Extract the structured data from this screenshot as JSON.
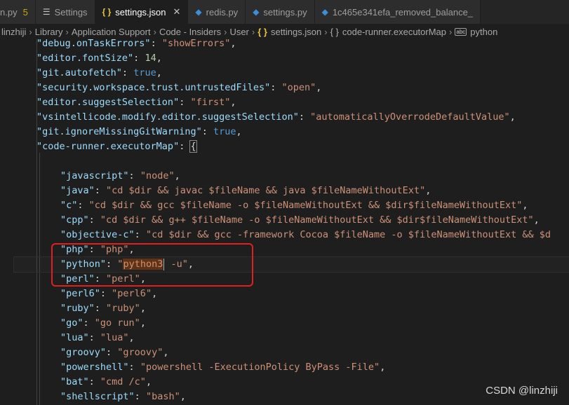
{
  "tabs": [
    {
      "label": "n.py",
      "icon": "python-file-icon",
      "badge": "5",
      "active": false
    },
    {
      "label": "Settings",
      "icon": "settings-icon",
      "active": false
    },
    {
      "label": "settings.json",
      "icon": "json-file-icon",
      "active": true
    },
    {
      "label": "redis.py",
      "icon": "python-file-icon",
      "active": false
    },
    {
      "label": "settings.py",
      "icon": "python-file-icon",
      "active": false
    },
    {
      "label": "1c465e341efa_removed_balance_",
      "icon": "python-file-icon",
      "active": false
    }
  ],
  "close_glyph": "✕",
  "breadcrumb": {
    "parts": [
      "linzhiji",
      "Library",
      "Application Support",
      "Code - Insiders",
      "User",
      "settings.json",
      "code-runner.executorMap",
      "python"
    ],
    "json_icon": "{ }",
    "object_icon": "{ }",
    "string_icon": "abc"
  },
  "code": {
    "top": [
      {
        "key": "\"debug.onTaskErrors\"",
        "type": "s",
        "value": "\"showErrors\"",
        "end": ","
      },
      {
        "key": "\"editor.fontSize\"",
        "type": "n",
        "value": "14",
        "end": ","
      },
      {
        "key": "\"git.autofetch\"",
        "type": "b",
        "value": "true",
        "end": ","
      },
      {
        "key": "\"security.workspace.trust.untrustedFiles\"",
        "type": "s",
        "value": "\"open\"",
        "end": ","
      },
      {
        "key": "\"editor.suggestSelection\"",
        "type": "s",
        "value": "\"first\"",
        "end": ","
      },
      {
        "key": "\"vsintellicode.modify.editor.suggestSelection\"",
        "type": "s",
        "value": "\"automaticallyOverrodeDefaultValue\"",
        "end": ","
      },
      {
        "key": "\"git.ignoreMissingGitWarning\"",
        "type": "b",
        "value": "true",
        "end": ","
      },
      {
        "key": "\"code-runner.executorMap\"",
        "type": "brace",
        "value": "{",
        "end": ""
      }
    ],
    "executors": [
      {
        "key": "\"javascript\"",
        "value": "\"node\""
      },
      {
        "key": "\"java\"",
        "value": "\"cd $dir && javac $fileName && java $fileNameWithoutExt\""
      },
      {
        "key": "\"c\"",
        "value": "\"cd $dir && gcc $fileName -o $fileNameWithoutExt && $dir$fileNameWithoutExt\""
      },
      {
        "key": "\"cpp\"",
        "value": "\"cd $dir && g++ $fileName -o $fileNameWithoutExt && $dir$fileNameWithoutExt\""
      },
      {
        "key": "\"objective-c\"",
        "value": "\"cd $dir && gcc -framework Cocoa $fileName -o $fileNameWithoutExt && $d"
      },
      {
        "key": "\"php\"",
        "value": "\"php\""
      },
      {
        "key": "\"python\"",
        "value": "\"python3 -u\""
      },
      {
        "key": "\"perl\"",
        "value": "\"perl\""
      },
      {
        "key": "\"perl6\"",
        "value": "\"perl6\""
      },
      {
        "key": "\"ruby\"",
        "value": "\"ruby\""
      },
      {
        "key": "\"go\"",
        "value": "\"go run\""
      },
      {
        "key": "\"lua\"",
        "value": "\"lua\""
      },
      {
        "key": "\"groovy\"",
        "value": "\"groovy\""
      },
      {
        "key": "\"powershell\"",
        "value": "\"powershell -ExecutionPolicy ByPass -File\""
      },
      {
        "key": "\"bat\"",
        "value": "\"cmd /c\""
      },
      {
        "key": "\"shellscript\"",
        "value": "\"bash\""
      }
    ],
    "python_value_parts": {
      "quote_open": "\"",
      "highlight": "python3",
      "rest": " -u\""
    },
    "current_line_key": "\"python\""
  },
  "watermark": "CSDN @linzhiji",
  "colors": {
    "background": "#1e1e1e",
    "key": "#9cdcfe",
    "string": "#ce9178",
    "number": "#b5cea8",
    "boolean": "#569cd6",
    "annotation_box": "#e02020",
    "match_highlight": "#613214"
  }
}
